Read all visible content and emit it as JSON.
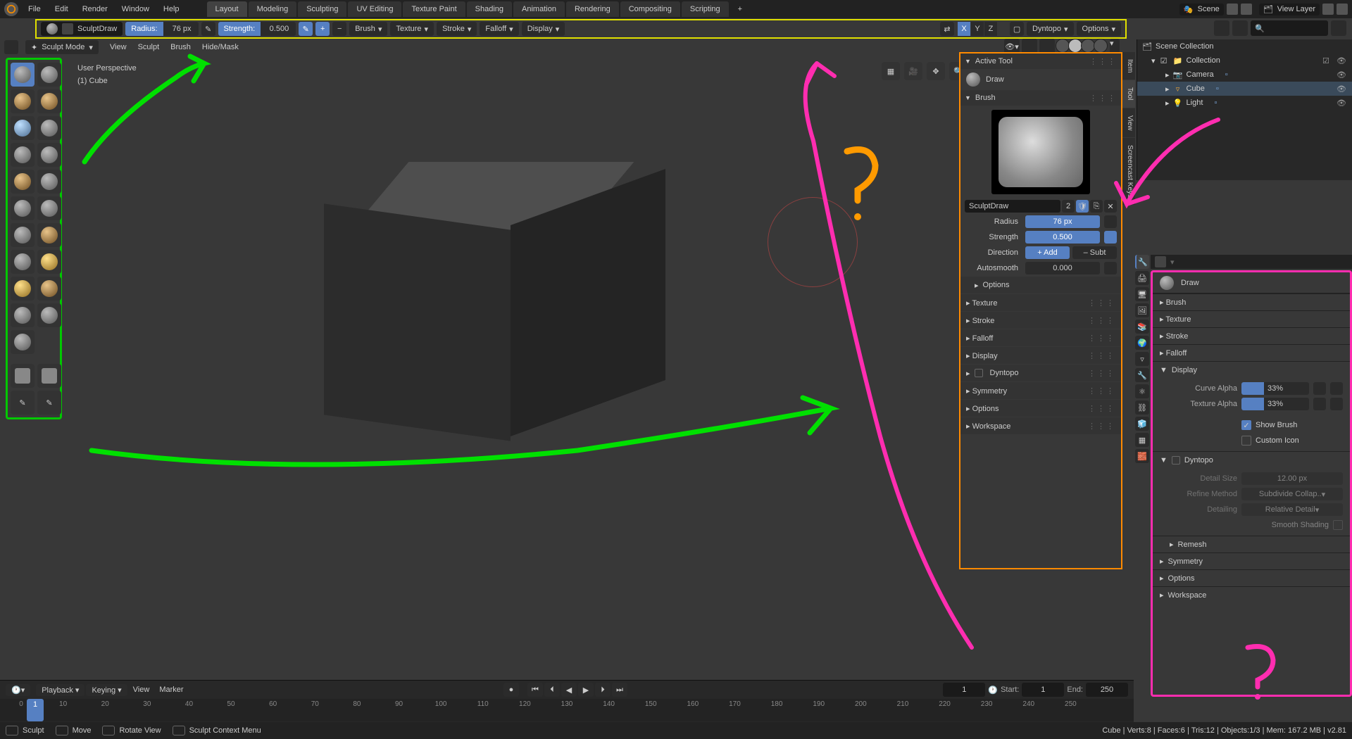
{
  "top": {
    "menus": [
      "File",
      "Edit",
      "Render",
      "Window",
      "Help"
    ],
    "workspaces": [
      "Layout",
      "Modeling",
      "Sculpting",
      "UV Editing",
      "Texture Paint",
      "Shading",
      "Animation",
      "Rendering",
      "Compositing",
      "Scripting"
    ],
    "active_ws": "Layout",
    "scene_label": "Scene",
    "layer_label": "View Layer"
  },
  "toolhdr": {
    "brush_name": "SculptDraw",
    "radius_label": "Radius:",
    "radius_value": "76 px",
    "strength_label": "Strength:",
    "strength_value": "0.500",
    "dds": [
      "Brush",
      "Texture",
      "Stroke",
      "Falloff",
      "Display"
    ],
    "mirror_x": "X",
    "mirror_y": "Y",
    "mirror_z": "Z",
    "dyntopo": "Dyntopo",
    "options": "Options"
  },
  "edhdr": {
    "mode": "Sculpt Mode",
    "menus": [
      "View",
      "Sculpt",
      "Brush",
      "Hide/Mask"
    ]
  },
  "vp": {
    "line1": "User Perspective",
    "line2": "(1)  Cube"
  },
  "tools": {
    "list": [
      "draw",
      "draw-sharp",
      "clay",
      "clay-strips",
      "layer",
      "inflate",
      "blob",
      "crease",
      "smooth",
      "flatten",
      "fill",
      "scrape",
      "pinch",
      "grab",
      "elastic",
      "snake-hook",
      "thumb",
      "pose",
      "nudge",
      "rotate",
      "simplify",
      "mask",
      "box-mask",
      "box-hide",
      "annotate"
    ],
    "active": "draw"
  },
  "ntabs": [
    "Item",
    "Tool",
    "View",
    "Screencast Keys"
  ],
  "ntabs_active": "Tool",
  "npanel": {
    "active_tool_label": "Active Tool",
    "tool_name": "Draw",
    "brush_label": "Brush",
    "brush_name": "SculptDraw",
    "brush_users": "2",
    "radius_l": "Radius",
    "radius_v": "76 px",
    "strength_l": "Strength",
    "strength_v": "0.500",
    "direction_l": "Direction",
    "add": "+ Add",
    "sub": "– Subt",
    "autosmooth_l": "Autosmooth",
    "autosmooth_v": "0.000",
    "options": "Options",
    "sections": [
      "Texture",
      "Stroke",
      "Falloff",
      "Display",
      "Dyntopo",
      "Symmetry",
      "Options",
      "Workspace"
    ]
  },
  "outliner": {
    "root": "Scene Collection",
    "coll": "Collection",
    "items": [
      "Camera",
      "Cube",
      "Light"
    ],
    "active": "Cube"
  },
  "props": {
    "title": "Draw",
    "sections_closed": [
      "Brush",
      "Texture",
      "Stroke",
      "Falloff"
    ],
    "display": "Display",
    "curve_alpha_l": "Curve Alpha",
    "curve_alpha_v": "33%",
    "tex_alpha_l": "Texture Alpha",
    "tex_alpha_v": "33%",
    "show_brush": "Show Brush",
    "custom_icon": "Custom Icon",
    "dyntopo": "Dyntopo",
    "detail_size_l": "Detail Size",
    "detail_size_v": "12.00 px",
    "refine_l": "Refine Method",
    "refine_v": "Subdivide Collap..",
    "detailing_l": "Detailing",
    "detailing_v": "Relative Detail",
    "smooth_shading": "Smooth Shading",
    "remesh": "Remesh",
    "symmetry": "Symmetry",
    "options": "Options",
    "workspace": "Workspace"
  },
  "timeline": {
    "menus": [
      "Playback",
      "Keying",
      "View",
      "Marker"
    ],
    "current": "1",
    "start_l": "Start:",
    "start_v": "1",
    "end_l": "End:",
    "end_v": "250",
    "ticks": [
      0,
      10,
      20,
      30,
      40,
      50,
      60,
      70,
      80,
      90,
      100,
      110,
      120,
      130,
      140,
      150,
      160,
      170,
      180,
      190,
      200,
      210,
      220,
      230,
      240,
      250
    ]
  },
  "status": {
    "sculpt": "Sculpt",
    "move": "Move",
    "rotate": "Rotate View",
    "menu": "Sculpt Context Menu",
    "right": "Cube | Verts:8 | Faces:6 | Tris:12 | Objects:1/3 | Mem: 167.2 MB | v2.81"
  }
}
